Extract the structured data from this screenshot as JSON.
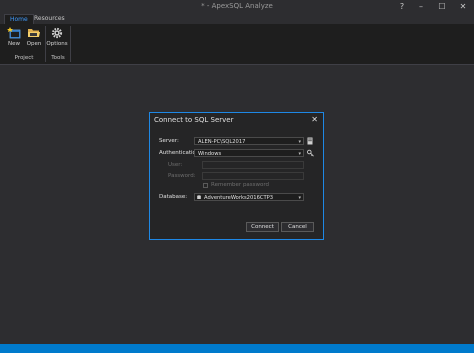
{
  "window": {
    "title": "* - ApexSQL Analyze",
    "controls": {
      "help": "?",
      "minimize": "–",
      "maximize": "☐",
      "close": "✕"
    }
  },
  "tabs": [
    {
      "label": "Home",
      "active": true
    },
    {
      "label": "Resources",
      "active": false
    }
  ],
  "ribbon": {
    "buttons": [
      {
        "label": "New",
        "icon": "new-project-icon"
      },
      {
        "label": "Open",
        "icon": "open-folder-icon"
      },
      {
        "label": "Options",
        "icon": "gear-icon"
      }
    ],
    "groups": [
      {
        "label": "Project"
      },
      {
        "label": "Tools"
      }
    ]
  },
  "dialog": {
    "title": "Connect to SQL Server",
    "close": "✕",
    "server_label": "Server:",
    "server_value": "ALEN-PC\\SQL2017",
    "auth_label": "Authentication:",
    "auth_value": "Windows",
    "user_label": "User:",
    "user_value": "",
    "password_label": "Password:",
    "password_value": "",
    "remember_label": "Remember password",
    "database_label": "Database:",
    "database_value": "AdventureWorks2016CTP3",
    "connect_label": "Connect",
    "cancel_label": "Cancel"
  },
  "colors": {
    "accent": "#1e88e5",
    "statusbar": "#007acc",
    "background": "#2d2d30"
  }
}
